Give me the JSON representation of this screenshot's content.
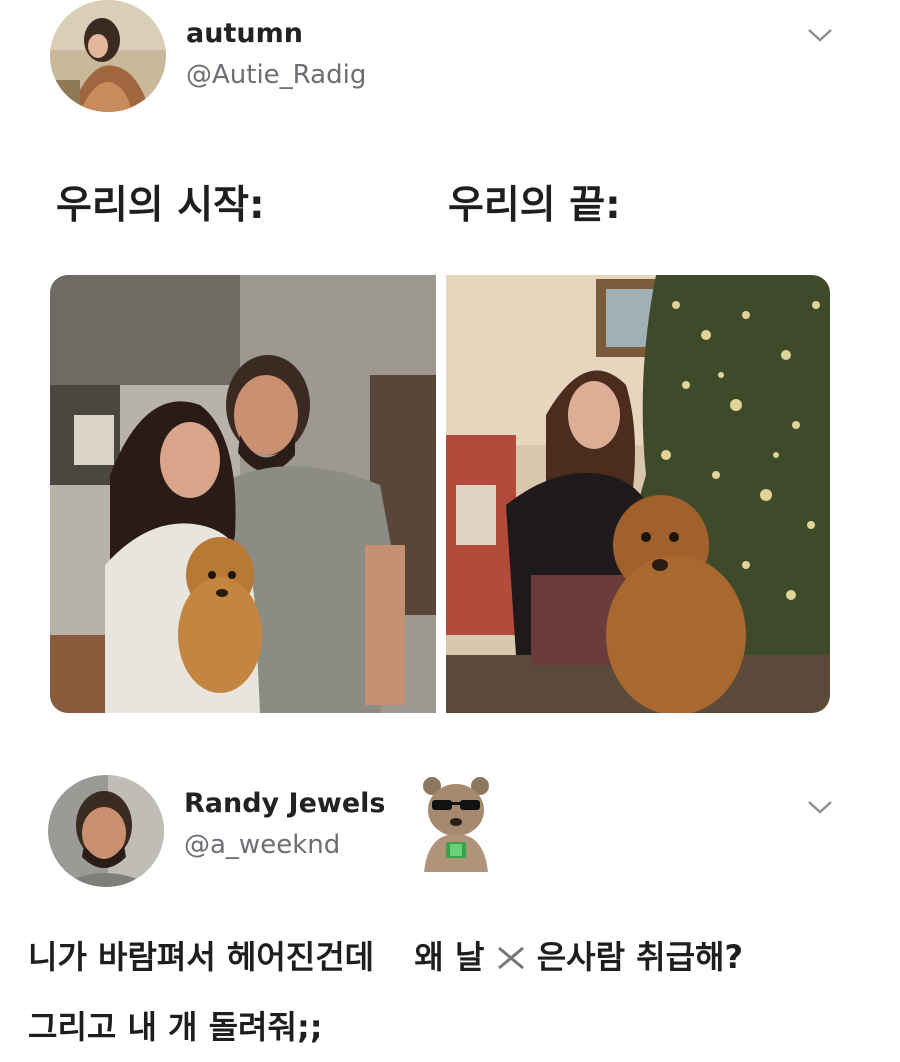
{
  "tweet1": {
    "display_name": "autumn",
    "handle": "@Autie_Radig",
    "caption_left": "우리의 시작:",
    "caption_right": "우리의 끝:",
    "menu_icon": "chevron-down-icon"
  },
  "tweet2": {
    "display_name": "Randy Jewels",
    "handle": "@a_weeknd",
    "menu_icon": "chevron-down-icon",
    "sticker_icon": "quokka-sunglasses-icon",
    "reply_line1_a": "니가 바람펴서 헤어진건데",
    "reply_line1_b": "왜 날",
    "reply_line1_c": "은사람 취급해?",
    "reply_line2": "그리고 내 개 돌려줘;;"
  }
}
